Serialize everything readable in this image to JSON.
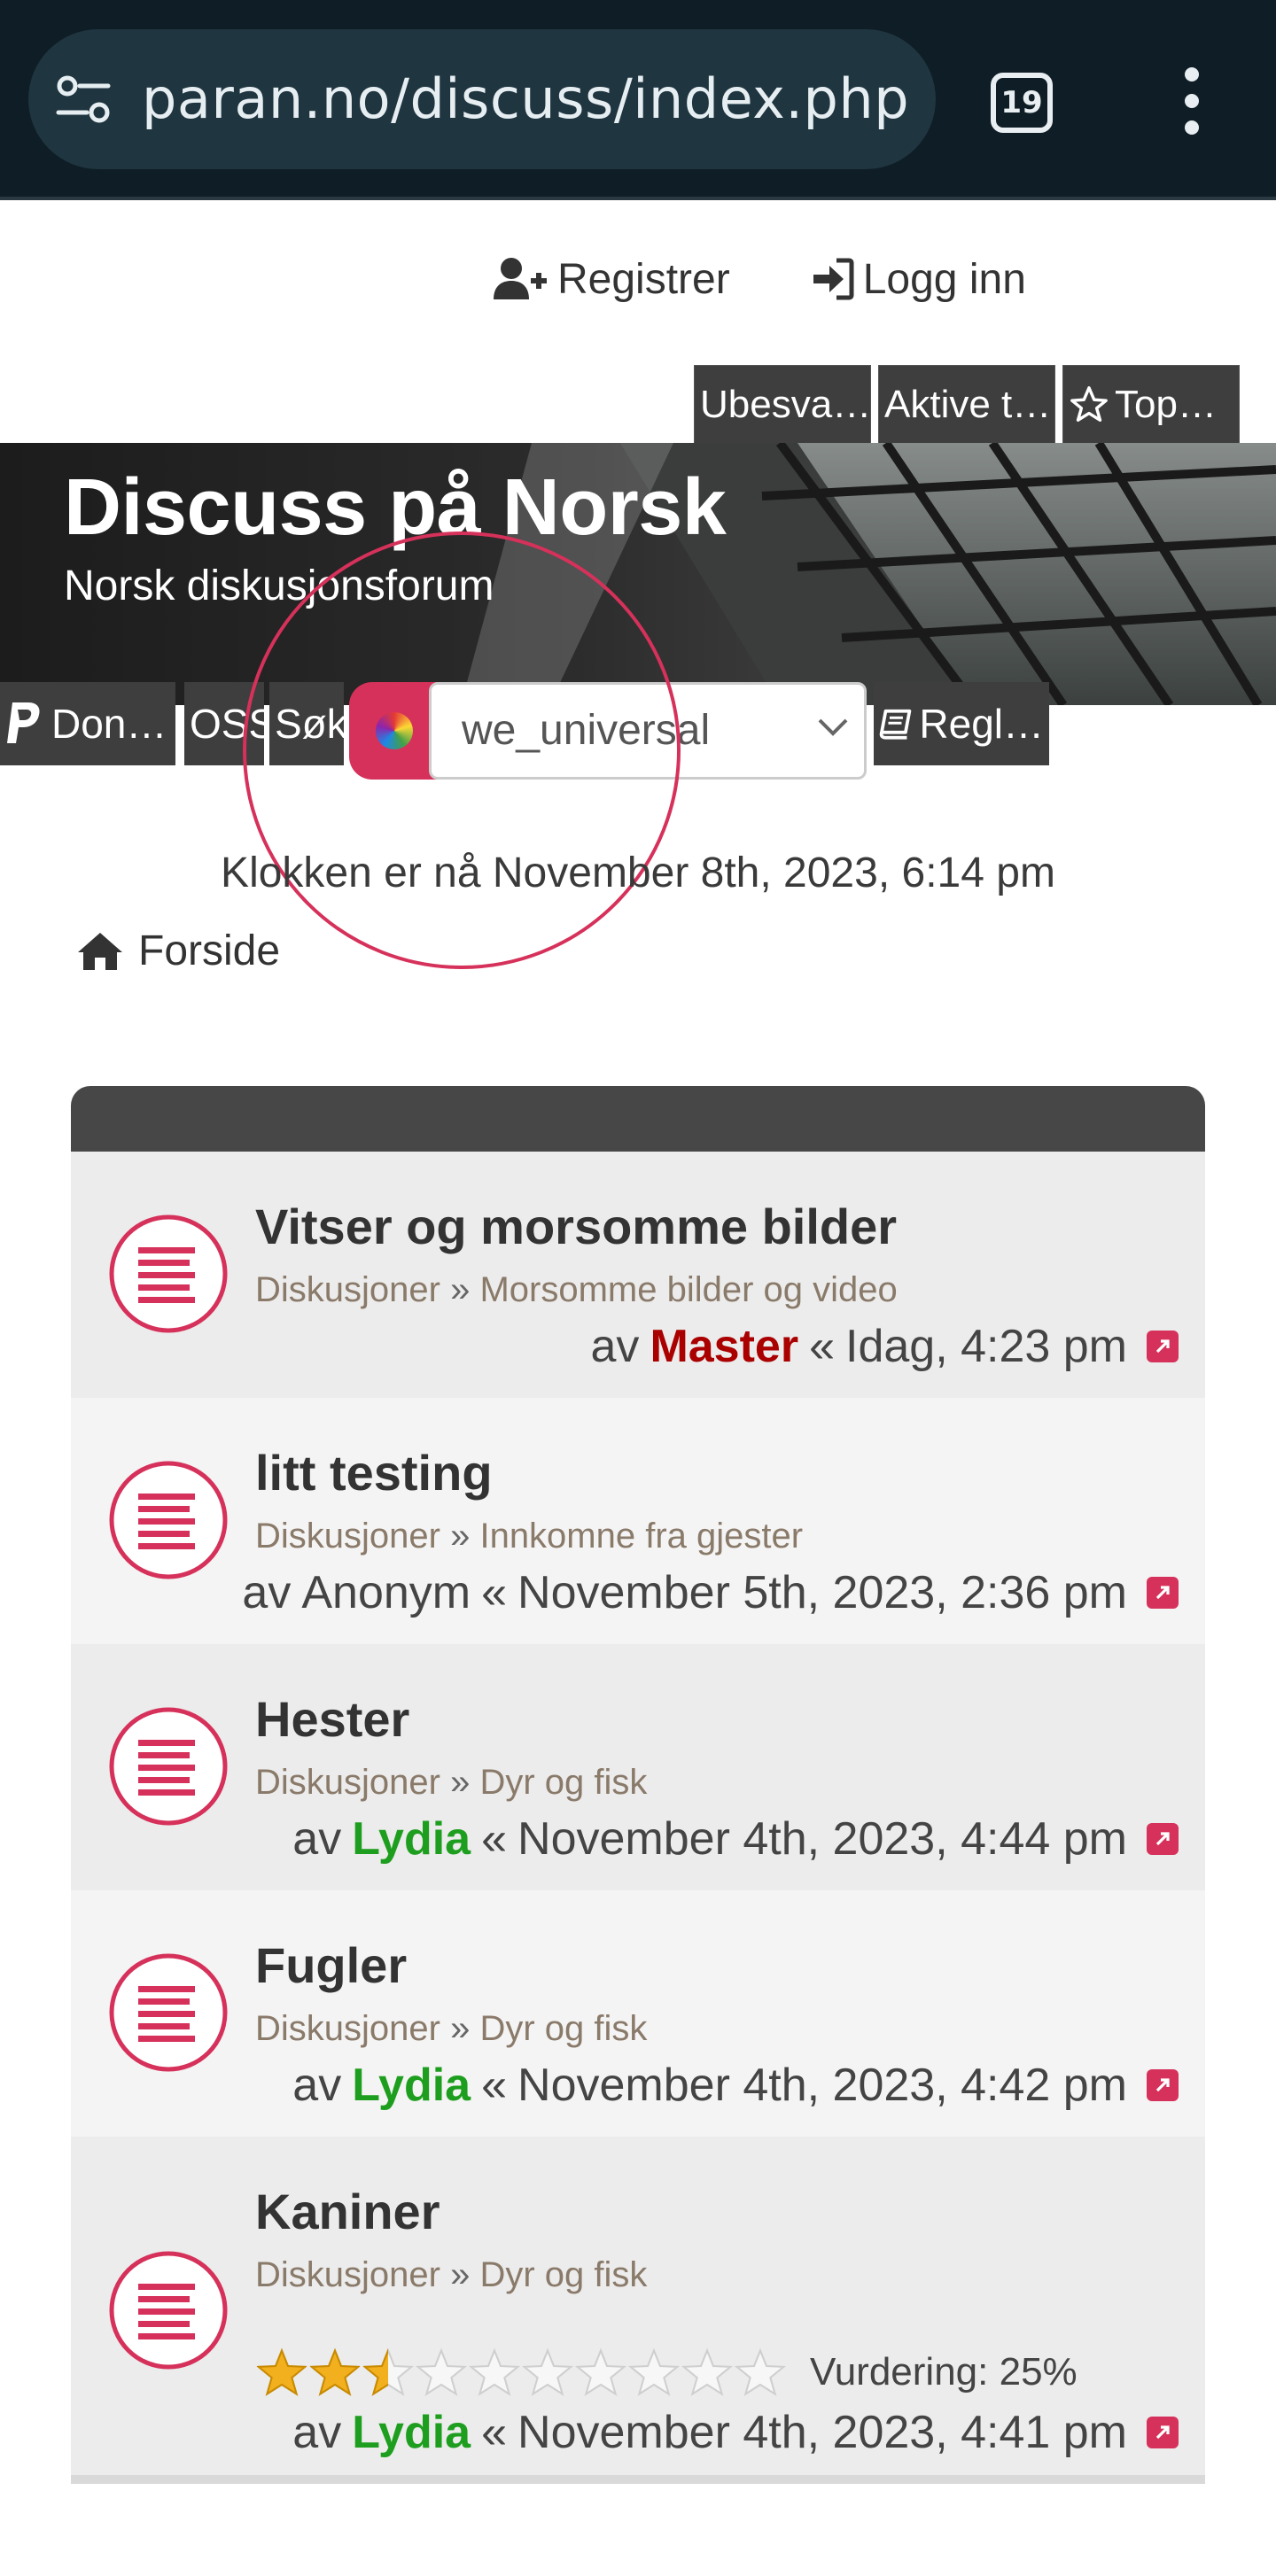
{
  "browser": {
    "url": "paran.no/discuss/index.php",
    "tab_count": "19"
  },
  "header": {
    "register_label": "Registrer",
    "login_label": "Logg inn",
    "quick_links": [
      "Ubesva…",
      "Aktive t…",
      "Top…"
    ]
  },
  "site": {
    "title": "Discuss på Norsk",
    "description": "Norsk diskusjonsforum"
  },
  "nav": {
    "donate_label": "Don…",
    "oss_label": "OSS",
    "search_label": "Søk",
    "style_selected": "we_universal",
    "rules_label": "Regl…"
  },
  "time_text": "Klokken er nå November 8th, 2023, 6:14 pm",
  "breadcrumb": {
    "home_label": "Forside"
  },
  "colors": {
    "accent": "#d6315a",
    "admin": "#aa0000",
    "member_green": "#1e9e1e",
    "dark_bar": "#3e3e3e"
  },
  "topics": [
    {
      "title": "Vitser og morsomme bilder",
      "parent": "Diskusjoner",
      "forum": "Morsomme bilder og video",
      "by": "av",
      "author": "Master",
      "author_color": "#aa0000",
      "sep": "«",
      "date": "Idag, 4:23 pm"
    },
    {
      "title": "litt testing",
      "parent": "Diskusjoner",
      "forum": "Innkomne fra gjester",
      "by": "av",
      "author": "Anonym",
      "author_color": "#444444",
      "sep": "«",
      "date": "November 5th, 2023, 2:36 pm"
    },
    {
      "title": "Hester",
      "parent": "Diskusjoner",
      "forum": "Dyr og fisk",
      "by": "av",
      "author": "Lydia",
      "author_color": "#1e9e1e",
      "sep": "«",
      "date": "November 4th, 2023, 4:44 pm"
    },
    {
      "title": "Fugler",
      "parent": "Diskusjoner",
      "forum": "Dyr og fisk",
      "by": "av",
      "author": "Lydia",
      "author_color": "#1e9e1e",
      "sep": "«",
      "date": "November 4th, 2023, 4:42 pm"
    },
    {
      "title": "Kaniner",
      "parent": "Diskusjoner",
      "forum": "Dyr og fisk",
      "by": "av",
      "author": "Lydia",
      "author_color": "#1e9e1e",
      "sep": "«",
      "date": "November 4th, 2023, 4:41 pm",
      "rating_label": "Vurdering: 25%",
      "rating_stars_filled": 2.5,
      "rating_stars_total": 10
    }
  ]
}
